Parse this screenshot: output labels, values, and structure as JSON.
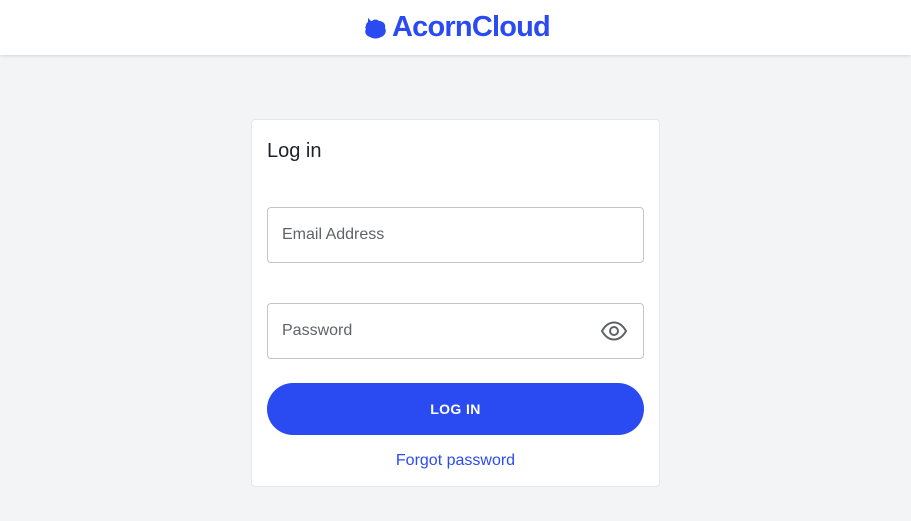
{
  "header": {
    "brand_name": "AcornCloud",
    "brand_icon": "acorn-icon",
    "brand_color": "#2b4bf2"
  },
  "login": {
    "title": "Log in",
    "email": {
      "placeholder": "Email Address",
      "value": ""
    },
    "password": {
      "placeholder": "Password",
      "value": "",
      "toggle_icon": "eye-icon"
    },
    "submit_label": "LOG IN",
    "forgot_label": "Forgot password"
  },
  "colors": {
    "accent": "#2b4bf2",
    "page_background": "#f3f4f6",
    "card_background": "#ffffff"
  }
}
